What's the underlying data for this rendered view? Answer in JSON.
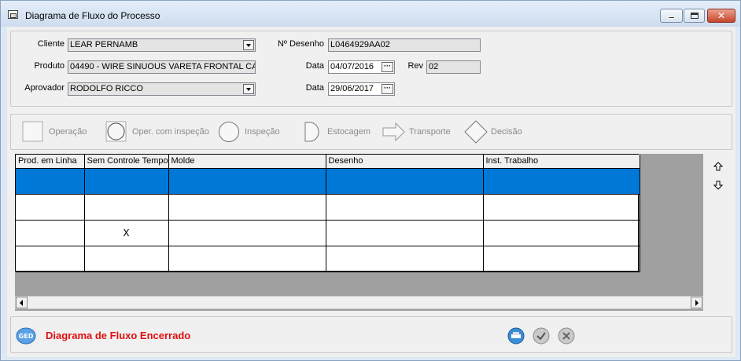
{
  "window": {
    "title": "Diagrama de Fluxo do Processo",
    "controls": {
      "minimize": "minimize",
      "maximize": "maximize",
      "close": "✕"
    }
  },
  "form": {
    "cliente": {
      "label": "Cliente",
      "value": "LEAR PERNAMB"
    },
    "produto": {
      "label": "Produto",
      "value": "04490 - WIRE SINUOUS VARETA FRONTAL CA"
    },
    "aprovador": {
      "label": "Aprovador",
      "value": "RODOLFO RICCO"
    },
    "desenho": {
      "label": "Nº Desenho",
      "value": "L0464929AA02"
    },
    "data1": {
      "label": "Data",
      "value": "04/07/2016"
    },
    "rev": {
      "label": "Rev",
      "value": "02"
    },
    "data2": {
      "label": "Data",
      "value": "29/06/2017"
    },
    "ellipsis": "···"
  },
  "legend": [
    {
      "id": "operacao",
      "label": "Operação",
      "icon": "square-icon"
    },
    {
      "id": "oper_inspecao",
      "label": "Oper. com inspeção",
      "icon": "circle-in-square-icon"
    },
    {
      "id": "inspecao",
      "label": "Inspeção",
      "icon": "circle-icon"
    },
    {
      "id": "estocagem",
      "label": "Estocagem",
      "icon": "d-shape-icon"
    },
    {
      "id": "transporte",
      "label": "Transporte",
      "icon": "arrow-right-icon"
    },
    {
      "id": "decisao",
      "label": "Decisão",
      "icon": "diamond-icon"
    }
  ],
  "grid": {
    "columns": [
      "Prod. em Linha",
      "Sem Controle Tempo",
      "Molde",
      "Desenho",
      "Inst. Trabalho"
    ],
    "rows": [
      [
        "",
        "",
        "",
        "",
        ""
      ],
      [
        "",
        "",
        "",
        "",
        ""
      ],
      [
        "",
        "X",
        "",
        "",
        ""
      ],
      [
        "",
        "",
        "",
        "",
        ""
      ]
    ],
    "selected_row": 0
  },
  "footer": {
    "ged_label": "GED",
    "status": "Diagrama de Fluxo Encerrado"
  },
  "colors": {
    "status": "#e01010",
    "selection": "#0078d7"
  }
}
